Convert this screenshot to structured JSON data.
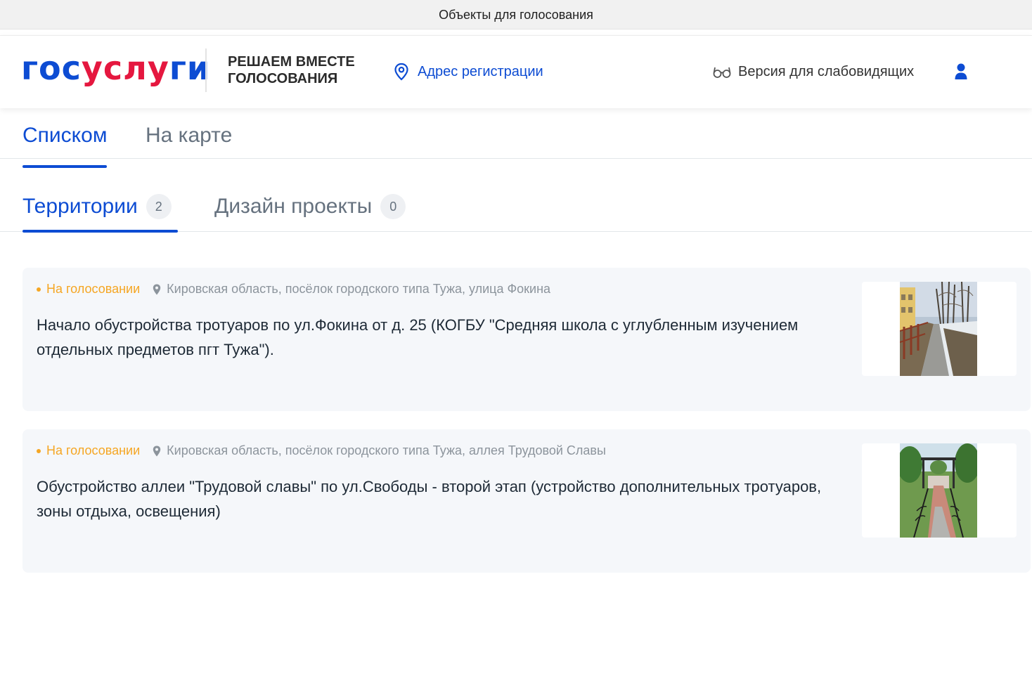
{
  "window": {
    "title": "Объекты для голосования"
  },
  "header": {
    "logo": {
      "part1": "гос",
      "part2": "услу",
      "part3": "ги"
    },
    "slogan_line1": "РЕШАЕМ ВМЕСТЕ",
    "slogan_line2": "ГОЛОСОВАНИЯ",
    "address_link": "Адрес регистрации",
    "low_vision": "Версия для слабовидящих"
  },
  "view_tabs": [
    {
      "label": "Списком",
      "active": true
    },
    {
      "label": "На карте",
      "active": false
    }
  ],
  "category_tabs": [
    {
      "label": "Территории",
      "count": "2",
      "active": true
    },
    {
      "label": "Дизайн проекты",
      "count": "0",
      "active": false
    }
  ],
  "cards": [
    {
      "status": "На голосовании",
      "location": "Кировская область, посёлок городского типа Тужа, улица Фокина",
      "title": "Начало обустройства тротуаров по ул.Фокина от д. 25 (КОГБУ \"Средняя школа с углубленным изучением отдельных предметов пгт Тужа\")."
    },
    {
      "status": "На голосовании",
      "location": "Кировская область, посёлок городского типа Тужа, аллея Трудовой Славы",
      "title": "Обустройство аллеи \"Трудовой славы\" по ул.Свободы - второй этап (устройство дополнительных тротуаров, зоны отдыха, освещения)"
    }
  ],
  "colors": {
    "brand_blue": "#0d4cd3",
    "brand_red": "#e5173f",
    "status_orange": "#f5a623",
    "card_bg": "#f5f7fa"
  },
  "icons": {
    "address": "map-pin-icon",
    "low_vision": "glasses-icon",
    "user": "user-icon",
    "location": "location-pin-icon"
  }
}
